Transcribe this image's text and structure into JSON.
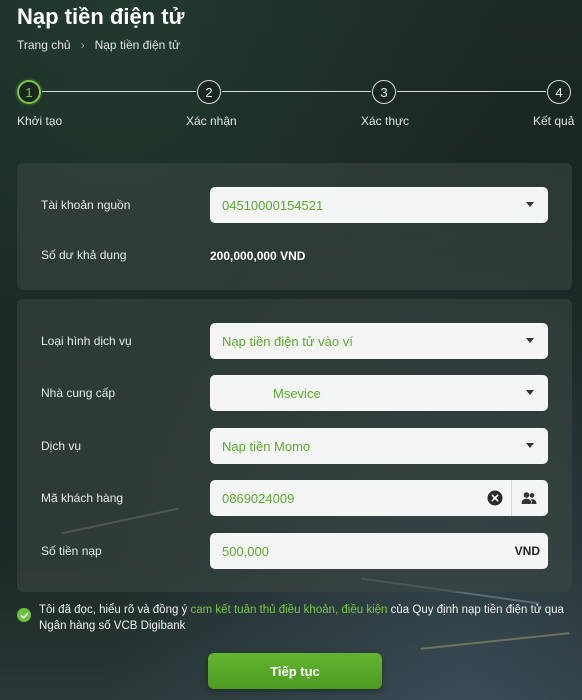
{
  "header": {
    "title": "Nạp tiền điện tử",
    "breadcrumb": {
      "home": "Trang chủ",
      "separator": "›",
      "current": "Nạp tiền điện tử"
    }
  },
  "stepper": {
    "steps": [
      {
        "number": "1",
        "label": "Khởi tạo",
        "active": true
      },
      {
        "number": "2",
        "label": "Xác nhận",
        "active": false
      },
      {
        "number": "3",
        "label": "Xác thực",
        "active": false
      },
      {
        "number": "4",
        "label": "Kết quả",
        "active": false
      }
    ]
  },
  "source": {
    "account_label": "Tài khoản nguồn",
    "account_value": "04510000154521",
    "balance_label": "Số dư khả dụng",
    "balance_value": "200,000,000 VND"
  },
  "service": {
    "type_label": "Loại hình dịch vụ",
    "type_value": "Nạp tiền điện tử vào ví",
    "provider_label": "Nhà cung cấp",
    "provider_value": "Msevice",
    "service_label": "Dịch vụ",
    "service_value": "Nạp tiền Momo",
    "customer_label": "Mã khách hàng",
    "customer_value": "0869024009",
    "amount_label": "Số tiền nạp",
    "amount_value": "500,000",
    "amount_unit": "VND"
  },
  "consent": {
    "prefix": "Tôi đã đọc, hiểu rõ và đồng ý ",
    "link": "cam kết tuân thủ điều khoản, điều kiện",
    "suffix": " của Quy định nạp tiền điện tử qua Ngân hàng số VCB Digibank",
    "checked": true
  },
  "actions": {
    "continue_label": "Tiếp tục"
  },
  "colors": {
    "accent": "#7ac943",
    "button": "#5aab2a",
    "panel": "#3c4844"
  },
  "icons": {
    "dropdown": "chevron-down-icon",
    "clear": "clear-icon",
    "contacts": "contacts-icon",
    "check": "check-icon"
  }
}
